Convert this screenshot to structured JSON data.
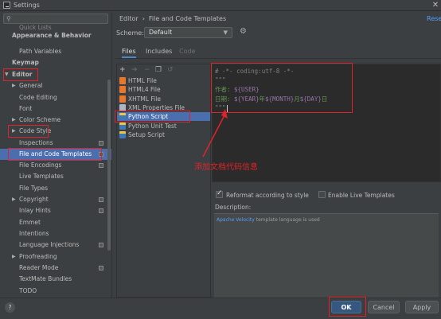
{
  "window": {
    "title": "Settings",
    "close_glyph": "✕"
  },
  "sidebar": {
    "search_icon": "magnifier-icon",
    "items": [
      {
        "label": "Quick Lists"
      },
      {
        "label": "Path Variables"
      },
      {
        "label": "Keymap"
      },
      {
        "label": "Editor"
      },
      {
        "label": "General"
      },
      {
        "label": "Code Editing"
      },
      {
        "label": "Font"
      },
      {
        "label": "Color Scheme"
      },
      {
        "label": "Code Style"
      },
      {
        "label": "Inspections"
      },
      {
        "label": "File and Code Templates"
      },
      {
        "label": "File Encodings"
      },
      {
        "label": "Live Templates"
      },
      {
        "label": "File Types"
      },
      {
        "label": "Copyright"
      },
      {
        "label": "Inlay Hints"
      },
      {
        "label": "Emmet"
      },
      {
        "label": "Intentions"
      },
      {
        "label": "Language Injections"
      },
      {
        "label": "Proofreading"
      },
      {
        "label": "Reader Mode"
      },
      {
        "label": "TextMate Bundles"
      },
      {
        "label": "TODO"
      }
    ],
    "section_header": "Appearance & Behavior"
  },
  "breadcrumb": {
    "root": "Editor",
    "separator": "›",
    "page": "File and Code Templates"
  },
  "reset_link": "Rese",
  "scheme": {
    "label": "Scheme:",
    "value": "Default"
  },
  "tabs": [
    {
      "label": "Files"
    },
    {
      "label": "Includes"
    },
    {
      "label": "Code"
    }
  ],
  "toolbar_icons": [
    "+",
    "➔",
    "−",
    "❐",
    "↺"
  ],
  "files": [
    {
      "label": "HTML File",
      "color": "#e8772e"
    },
    {
      "label": "HTML4 File",
      "color": "#e8772e"
    },
    {
      "label": "XHTML File",
      "color": "#e8772e"
    },
    {
      "label": "XML Properties File",
      "color": "#a9b7c6"
    },
    {
      "label": "Python Script",
      "color": "#3d78b8"
    },
    {
      "label": "Python Unit Test",
      "color": "#3d78b8"
    },
    {
      "label": "Setup Script",
      "color": "#3d78b8"
    }
  ],
  "editor": {
    "line1": "# -*- coding:utf-8 -*-",
    "line2": "\"\"\"",
    "line3_prefix": "作者: ",
    "line3_var": "${USER}",
    "line4_prefix": "日期: ",
    "line4_var1": "${YEAR}",
    "line4_sep1": "年",
    "line4_var2": "${MONTH}",
    "line4_sep2": "月",
    "line4_var3": "${DAY}",
    "line4_sep3": "日",
    "line5": "\"\"\""
  },
  "annotation": "添加文档代码信息",
  "options": {
    "reformat_label": "Reformat according to style",
    "reformat_checked": true,
    "live_templates_label": "Enable Live Templates",
    "live_templates_checked": false
  },
  "description": {
    "label": "Description:",
    "link": "Apache Velocity",
    "text": " template language is used"
  },
  "buttons": {
    "help": "?",
    "ok": "OK",
    "cancel": "Cancel",
    "apply": "Apply"
  },
  "colors": {
    "accent": "#4b6eaf",
    "annotation_red": "#e0232a",
    "primary_button": "#365880"
  }
}
